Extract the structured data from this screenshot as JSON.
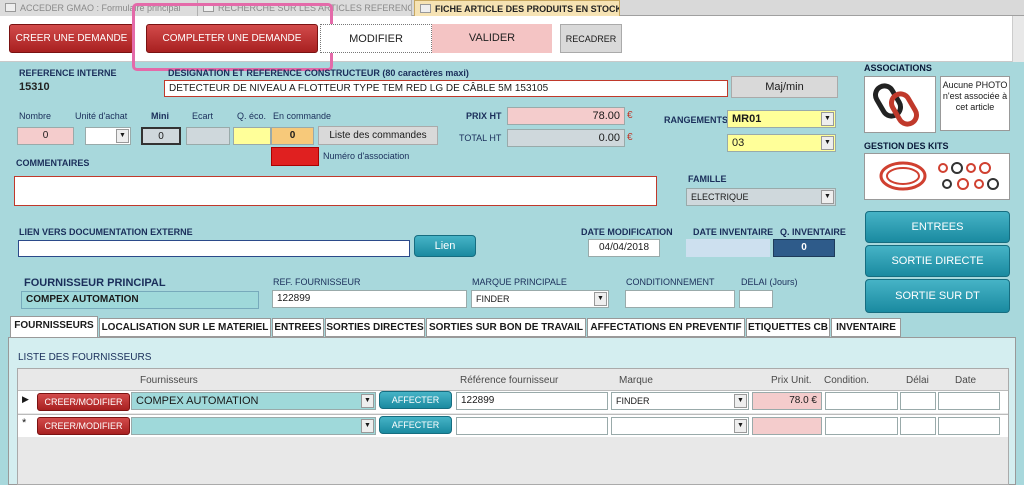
{
  "window_tabs": [
    {
      "label": "ACCEDER GMAO : Formulaire principal"
    },
    {
      "label": "RECHERCHE SUR LES ARTICLES REFERENCES"
    },
    {
      "label": "FICHE ARTICLE DES PRODUITS EN STOCK"
    }
  ],
  "toolbar": {
    "creer": "CREER UNE DEMANDE",
    "completer": "COMPLETER UNE DEMANDE",
    "modifier": "MODIFIER",
    "valider": "VALIDER",
    "recadrer": "RECADRER"
  },
  "article": {
    "ref_label": "REFERENCE INTERNE",
    "ref_value": "15310",
    "designation_label": "DESIGNATION ET REFERENCE CONSTRUCTEUR (80 caractères maxi)",
    "designation_value": "DETECTEUR DE NIVEAU A FLOTTEUR TYPE TEM RED LG DE CÂBLE 5M 153105",
    "majmin": "Maj/min"
  },
  "stock": {
    "nombre_label": "Nombre",
    "nombre_value": "0",
    "unite_label": "Unité d'achat",
    "unite_value": "",
    "mini_label": "Mini",
    "mini_value": "0",
    "ecart_label": "Ecart",
    "ecart_value": "",
    "qeco_label": "Q. éco.",
    "qeco_value": "",
    "commande_label": "En commande",
    "commande_value": "0",
    "liste_btn": "Liste des commandes",
    "association_label": "Numéro d'association"
  },
  "prix": {
    "ht_label": "PRIX HT",
    "ht_value": "78.00",
    "total_label": "TOTAL HT",
    "total_value": "0.00",
    "currency": "€"
  },
  "rangements": {
    "label": "RANGEMENTS",
    "value1": "MR01",
    "value2": "03"
  },
  "commentaires_label": "COMMENTAIRES",
  "famille": {
    "label": "FAMILLE",
    "value": "ELECTRIQUE"
  },
  "lien": {
    "label": "LIEN VERS DOCUMENTATION EXTERNE",
    "button": "Lien",
    "value": ""
  },
  "dates": {
    "modif_label": "DATE MODIFICATION",
    "modif_value": "04/04/2018",
    "inv_label": "DATE INVENTAIRE",
    "inv_value": "",
    "qinv_label": "Q. INVENTAIRE",
    "qinv_value": "0"
  },
  "fournisseur": {
    "principal_label": "FOURNISSEUR PRINCIPAL",
    "principal_value": "COMPEX AUTOMATION",
    "ref_label": "REF. FOURNISSEUR",
    "ref_value": "122899",
    "marque_label": "MARQUE PRINCIPALE",
    "marque_value": "FINDER",
    "cond_label": "CONDITIONNEMENT",
    "cond_value": "",
    "delai_label": "DELAI (Jours)",
    "delai_value": ""
  },
  "associations": {
    "label": "ASSOCIATIONS",
    "photo_text": "Aucune PHOTO n'est associée à cet article",
    "kits_label": "GESTION DES KITS"
  },
  "side_buttons": {
    "entrees": "ENTREES",
    "sortie_directe": "SORTIE DIRECTE",
    "sortie_dt": "SORTIE SUR DT"
  },
  "tabs": [
    "FOURNISSEURS",
    "LOCALISATION SUR LE MATERIEL",
    "ENTREES",
    "SORTIES DIRECTES",
    "SORTIES SUR BON DE TRAVAIL",
    "AFFECTATIONS EN PREVENTIF",
    "ETIQUETTES CB",
    "INVENTAIRE"
  ],
  "liste": {
    "title": "LISTE DES FOURNISSEURS",
    "headers": [
      "Fournisseurs",
      "Référence fournisseur",
      "Marque",
      "Prix Unit.",
      "Condition.",
      "Délai",
      "Date"
    ],
    "rows": [
      {
        "marker": "▶",
        "btn": "CREER/MODIFIER",
        "fournisseur": "COMPEX AUTOMATION",
        "affecter": "AFFECTER",
        "ref": "122899",
        "marque": "FINDER",
        "prix": "78.0 €",
        "cond": "",
        "delai": "",
        "date": ""
      },
      {
        "marker": "*",
        "btn": "CREER/MODIFIER",
        "fournisseur": "",
        "affecter": "AFFECTER",
        "ref": "",
        "marque": "",
        "prix": "",
        "cond": "",
        "delai": "",
        "date": ""
      }
    ]
  }
}
